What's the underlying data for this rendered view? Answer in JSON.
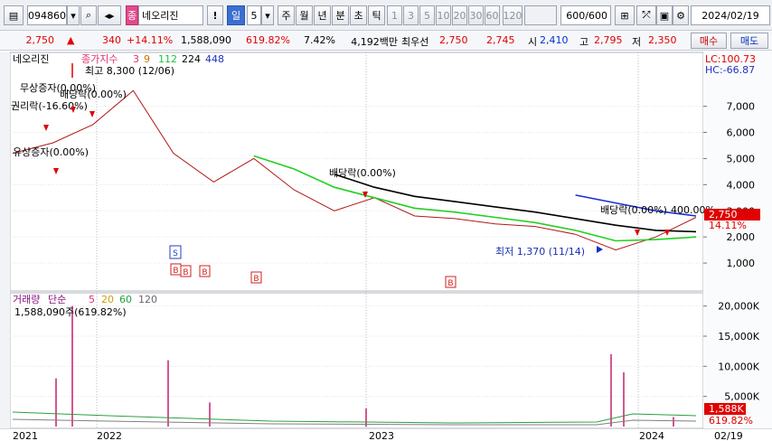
{
  "toolbar": {
    "code": "094860",
    "stock_name": "네오리진",
    "tag": "종",
    "periods": [
      "일",
      "5",
      "주",
      "월",
      "년",
      "분",
      "초",
      "틱"
    ],
    "intervals": [
      "1",
      "3",
      "5",
      "10",
      "20",
      "30",
      "60",
      "120"
    ],
    "count": "600/600",
    "date": "2024/02/19"
  },
  "quote": {
    "price": "2,750",
    "change": "340",
    "change_pct": "+14.11%",
    "volume": "1,588,090",
    "vol_ratio": "619.82%",
    "turnover": "7.42%",
    "amount": "4,192백만",
    "best_ask_label": "최우선",
    "best_ask": "2,750",
    "best_bid": "2,745",
    "open_label": "시",
    "open": "2,410",
    "high_label": "고",
    "high": "2,795",
    "low_label": "저",
    "low": "2,350",
    "buy_label": "매수",
    "sell_label": "매도"
  },
  "price_legend": {
    "name": "네오리진",
    "ind": "종가지수",
    "ma": [
      "3",
      "9",
      "112",
      "224",
      "448"
    ],
    "lc": "LC:100.73",
    "hc": "HC:-66.87",
    "cur_label": "2,750",
    "cur_pct": "14.11%"
  },
  "annotations": {
    "high": "최고 8,300 (12/06)",
    "low": "최저 1,370 (11/14)",
    "rights": "무상증자(0.00%)",
    "div1": "배당락(0.00%)",
    "ex_right": "권리락(-16.60%)",
    "rights2": "유상증자(0.00%)",
    "div2": "배당락(0.00%)",
    "right_cluster": "배당락(0.00%)",
    "right_cluster2": "400.00%"
  },
  "volume_legend": {
    "label": "거래량",
    "kind": "단순",
    "ma": [
      "5",
      "20",
      "60",
      "120"
    ],
    "value": "1,588,090주(619.82%)",
    "cur_label": "1,588K",
    "cur_pct": "619.82%"
  },
  "xaxis": [
    "2021",
    "2022",
    "2023",
    "2024",
    "02/19"
  ],
  "chart_data": [
    {
      "type": "line",
      "title": "네오리진 일봉",
      "x": [
        "2021-08",
        "2021-10",
        "2021-11",
        "2021-12",
        "2022-01",
        "2022-03",
        "2022-05",
        "2022-07",
        "2022-09",
        "2022-11",
        "2023-01",
        "2023-03",
        "2023-05",
        "2023-07",
        "2023-09",
        "2023-11",
        "2024-01",
        "2024-02"
      ],
      "series": [
        {
          "name": "종가",
          "values": [
            5200,
            5600,
            6300,
            7600,
            5200,
            4100,
            5000,
            3800,
            3000,
            3500,
            2800,
            2700,
            2500,
            2400,
            2100,
            1500,
            2000,
            2750
          ]
        },
        {
          "name": "112",
          "values": [
            null,
            null,
            null,
            null,
            null,
            null,
            5100,
            4600,
            3900,
            3500,
            3100,
            2950,
            2750,
            2550,
            2250,
            1850,
            1900,
            2000
          ]
        },
        {
          "name": "224",
          "values": [
            null,
            null,
            null,
            null,
            null,
            null,
            null,
            null,
            4400,
            3900,
            3550,
            3350,
            3150,
            2950,
            2700,
            2450,
            2250,
            2200
          ]
        },
        {
          "name": "448",
          "values": [
            null,
            null,
            null,
            null,
            null,
            null,
            null,
            null,
            null,
            null,
            null,
            null,
            null,
            null,
            3600,
            3300,
            3000,
            2800
          ]
        }
      ],
      "ylim": [
        0,
        8300
      ],
      "yticks": [
        "1,000",
        "2,000",
        "3,000",
        "4,000",
        "5,000",
        "6,000",
        "7,000"
      ]
    },
    {
      "type": "bar",
      "title": "거래량",
      "ylim": [
        0,
        21000
      ],
      "yticks": [
        "5,000K",
        "10,000K",
        "15,000K",
        "20,000K"
      ],
      "x": [
        "2021-11",
        "2021-12",
        "2022-06",
        "2022-08",
        "2023-01",
        "2023-12",
        "2024-01",
        "2024-02"
      ],
      "values": [
        8000,
        20000,
        11000,
        4000,
        3000,
        12000,
        9000,
        1588
      ]
    }
  ]
}
